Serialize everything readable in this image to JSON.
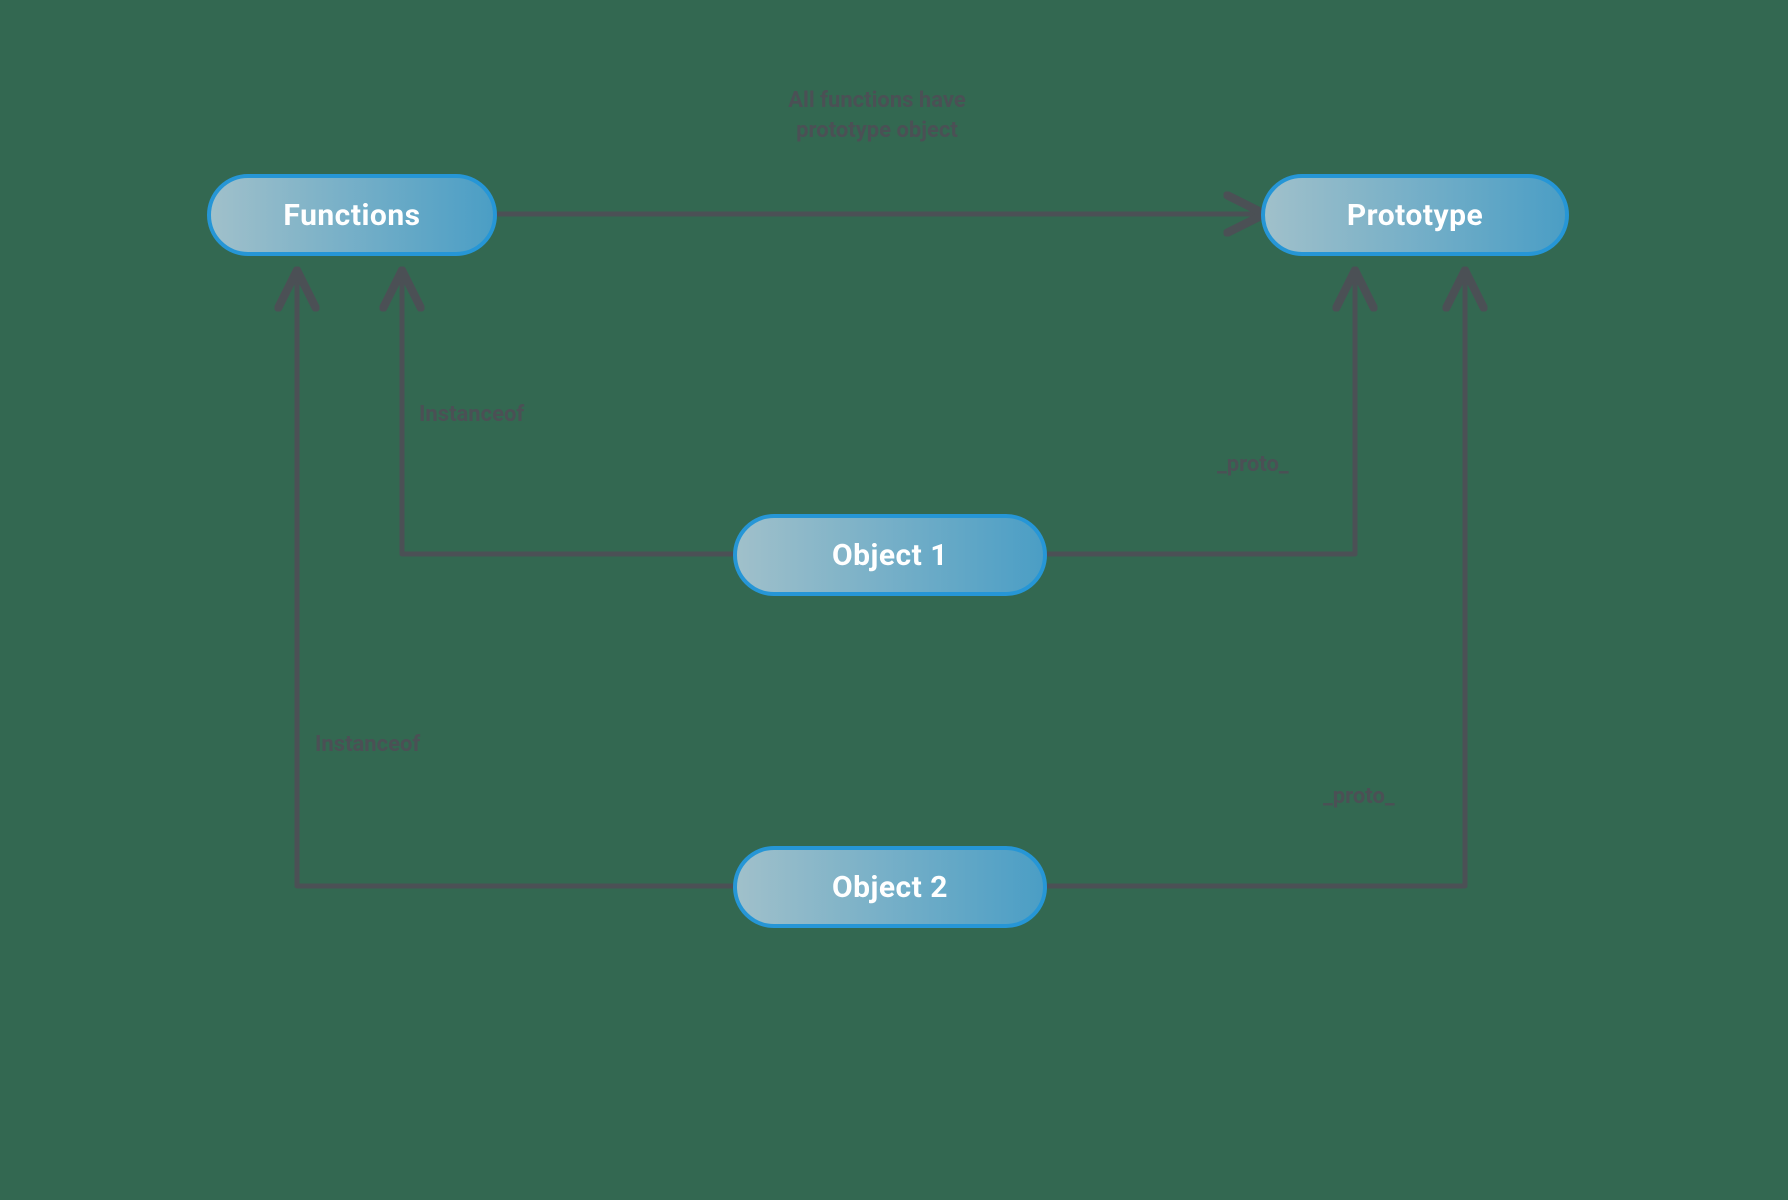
{
  "nodes": {
    "functions": {
      "label": "Functions"
    },
    "prototype": {
      "label": "Prototype"
    },
    "object1": {
      "label": "Object 1"
    },
    "object2": {
      "label": "Object 2"
    }
  },
  "edges": {
    "fn_to_proto": {
      "label": "All functions have\nprototype object"
    },
    "obj1_to_fn": {
      "label": "Instanceof"
    },
    "obj1_to_proto": {
      "label": "_proto_"
    },
    "obj2_to_fn": {
      "label": "Instanceof"
    },
    "obj2_to_proto": {
      "label": "_proto_"
    }
  },
  "colors": {
    "background": "#336851",
    "nodeBorder": "#2696d6",
    "nodeGradientStart": "#a0c0ca",
    "nodeGradientEnd": "#4b9ec5",
    "arrowStroke": "#4b5055",
    "text": "#ffffff"
  }
}
